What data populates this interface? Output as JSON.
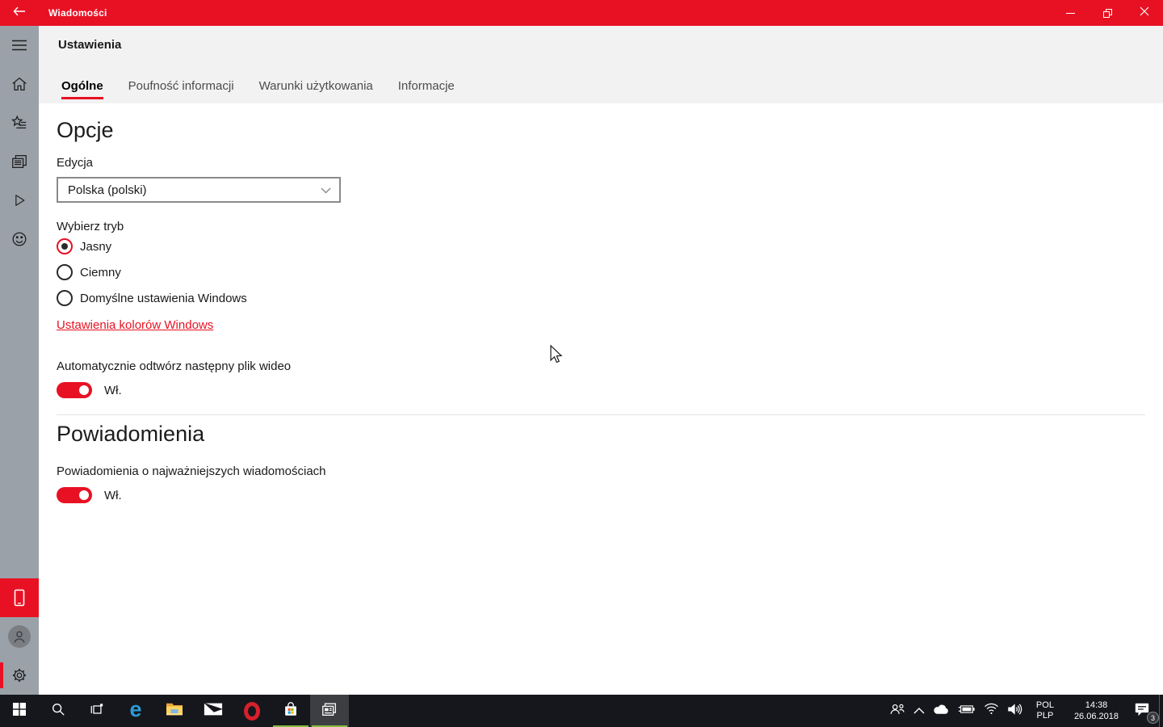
{
  "window": {
    "title": "Wiadomości"
  },
  "sidebar": {
    "top_icons": [
      "menu",
      "home",
      "interests",
      "news-sources",
      "video",
      "feedback"
    ],
    "bottom_icons": [
      "phone-promo",
      "account-avatar",
      "settings-gear"
    ],
    "active_item": "settings-gear"
  },
  "settings_page": {
    "title": "Ustawienia",
    "tabs": [
      {
        "label": "Ogólne",
        "active": true
      },
      {
        "label": "Poufność informacji",
        "active": false
      },
      {
        "label": "Warunki użytkowania",
        "active": false
      },
      {
        "label": "Informacje",
        "active": false
      }
    ],
    "options": {
      "heading": "Opcje",
      "edition_label": "Edycja",
      "edition_value": "Polska (polski)",
      "mode_label": "Wybierz tryb",
      "modes": [
        {
          "label": "Jasny",
          "selected": true
        },
        {
          "label": "Ciemny",
          "selected": false
        },
        {
          "label": "Domyślne ustawienia Windows",
          "selected": false
        }
      ],
      "colors_link": "Ustawienia kolorów Windows",
      "autoplay_label": "Automatycznie odtwórz następny plik wideo",
      "autoplay_state": "Wł.",
      "autoplay_on": true
    },
    "notifications": {
      "heading": "Powiadomienia",
      "label": "Powiadomienia o najważniejszych wiadomościach",
      "state": "Wł.",
      "on": true
    }
  },
  "taskbar": {
    "icons": [
      "start",
      "search",
      "task-view",
      "edge",
      "file-explorer",
      "mail",
      "opera",
      "store",
      "news"
    ],
    "running_apps": [
      "store",
      "news"
    ],
    "active_app": "news",
    "tray": {
      "icons": [
        "people",
        "hidden-icons-chevron",
        "onedrive",
        "battery-charging",
        "wifi",
        "volume"
      ],
      "language_line1": "POL",
      "language_line2": "PLP",
      "time": "14:38",
      "date": "26.06.2018",
      "notification_count": "3"
    }
  },
  "colors": {
    "accent_red": "#E81123",
    "sidebar_gray": "#9AA1A9",
    "header_gray": "#F2F2F2",
    "taskbar_dark": "#16171C",
    "running_underline_green": "#85BB40"
  }
}
